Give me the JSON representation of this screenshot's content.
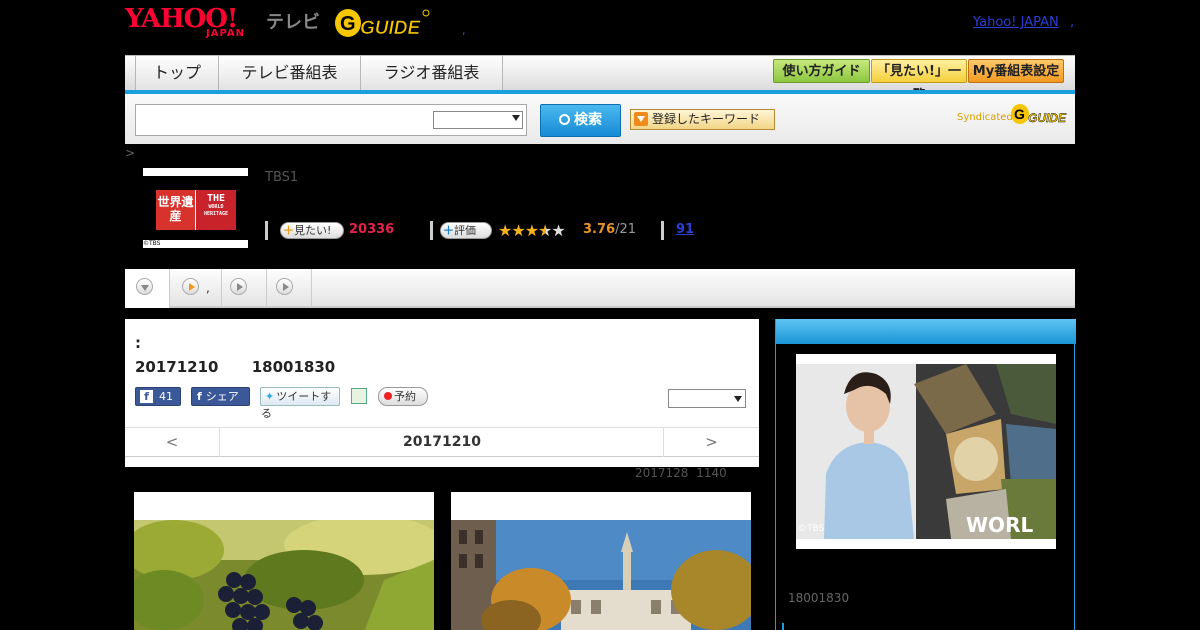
{
  "header": {
    "logo_yahoo": "YAHOO!",
    "logo_japan": "JAPAN",
    "logo_tv": "テレビ",
    "logo_gguide": "G-GUIDE",
    "dot": ",",
    "yahoo_link": "Yahoo! JAPAN",
    "yahoo_link_suffix": ","
  },
  "nav": {
    "tabs": [
      "トップ",
      "テレビ番組表",
      "ラジオ番組表"
    ],
    "guide_buttons": [
      "使い方ガイド",
      "「見たい!」一覧",
      "My番組表設定"
    ]
  },
  "search": {
    "button_label": "検索",
    "keyword_button": "登録したキーワード",
    "syndicated": "Syndicated"
  },
  "breadcrumb": ">",
  "program": {
    "channel": "TBS1",
    "thumb_left": "世界遺産",
    "thumb_right_1": "THE",
    "thumb_right_2": "WORLD",
    "thumb_right_3": "HERITAGE",
    "thumb_copyright": "©TBS",
    "mitai_label": "見たい!",
    "mitai_count": "20336",
    "rate_label": "評価",
    "stars": "★★★★★",
    "rating": "3.76",
    "rating_of": "/21",
    "reviews": "91"
  },
  "tabs": {
    "tab2_text": ","
  },
  "detail": {
    "title": ":",
    "date_time": "20171210 18001830",
    "fb_count": "41",
    "fb_share": "シェア",
    "tweet": "ツイートする",
    "reserve": "予約",
    "prev": "<",
    "current_date": "20171210",
    "next": ">",
    "update_note": "2017128 1140"
  },
  "sidebar": {
    "copyright": "©TBS",
    "time": "18001830"
  }
}
